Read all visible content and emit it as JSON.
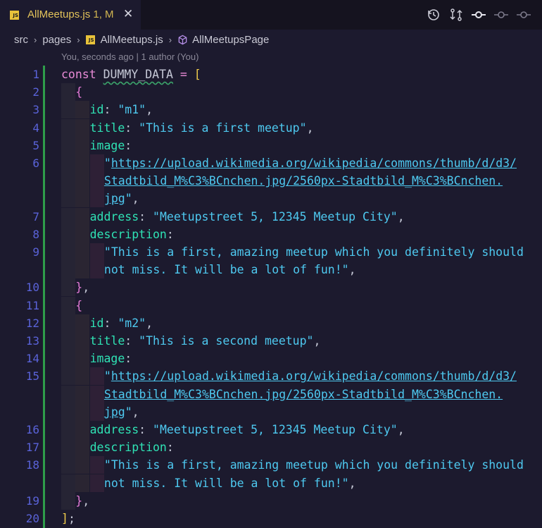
{
  "tab": {
    "filename": "AllMeetups.js",
    "meta": " 1, M",
    "close_glyph": "✕",
    "language_badge": "JS"
  },
  "toolbar_icons": [
    "history-icon",
    "compare-changes-icon",
    "git-commit-icon",
    "previous-change-icon",
    "next-change-icon"
  ],
  "breadcrumb": {
    "items": [
      "src",
      "pages",
      "AllMeetups.js",
      "AllMeetupsPage"
    ],
    "separator": "›"
  },
  "blame": "You, seconds ago | 1 author (You)",
  "colors": {
    "background": "#1c1a2e",
    "line_number": "#5a63d9",
    "keyword": "#e98bd7",
    "property": "#2fe3b5",
    "string": "#4ec9f0",
    "bracket_outer": "#f0cc4c",
    "bracket_inner": "#e47ad6",
    "git_added": "#2e9d4a"
  },
  "editor": {
    "lines": [
      {
        "num": "1",
        "indent": 0,
        "tokens": [
          [
            "kw",
            "const "
          ],
          [
            "var",
            "DUMMY_DATA"
          ],
          [
            "op",
            " = "
          ],
          [
            "br-y",
            "["
          ]
        ]
      },
      {
        "num": "2",
        "indent": 1,
        "tokens": [
          [
            "br-p",
            "{"
          ]
        ]
      },
      {
        "num": "3",
        "indent": 2,
        "tokens": [
          [
            "key",
            "id"
          ],
          [
            "punc",
            ": "
          ],
          [
            "str",
            "\"m1\""
          ],
          [
            "punc",
            ","
          ]
        ]
      },
      {
        "num": "4",
        "indent": 2,
        "tokens": [
          [
            "key",
            "title"
          ],
          [
            "punc",
            ": "
          ],
          [
            "str",
            "\"This is a first meetup\""
          ],
          [
            "punc",
            ","
          ]
        ]
      },
      {
        "num": "5",
        "indent": 2,
        "tokens": [
          [
            "key",
            "image"
          ],
          [
            "punc",
            ":"
          ]
        ]
      },
      {
        "num": "6",
        "indent": 3,
        "tokens": [
          [
            "str",
            "\""
          ],
          [
            "url",
            "https://upload.wikimedia.org/wikipedia/commons/thumb/d/d3/"
          ]
        ]
      },
      {
        "num": "",
        "indent": 3,
        "tokens": [
          [
            "url",
            "Stadtbild_M%C3%BCnchen.jpg/2560px-Stadtbild_M%C3%BCnchen."
          ]
        ]
      },
      {
        "num": "",
        "indent": 3,
        "tokens": [
          [
            "url",
            "jpg"
          ],
          [
            "str",
            "\""
          ],
          [
            "punc",
            ","
          ]
        ]
      },
      {
        "num": "7",
        "indent": 2,
        "tokens": [
          [
            "key",
            "address"
          ],
          [
            "punc",
            ": "
          ],
          [
            "str",
            "\"Meetupstreet 5, 12345 Meetup City\""
          ],
          [
            "punc",
            ","
          ]
        ]
      },
      {
        "num": "8",
        "indent": 2,
        "tokens": [
          [
            "key",
            "description"
          ],
          [
            "punc",
            ":"
          ]
        ]
      },
      {
        "num": "9",
        "indent": 3,
        "tokens": [
          [
            "str",
            "\"This is a first, amazing meetup which you definitely should"
          ]
        ]
      },
      {
        "num": "",
        "indent": 3,
        "tokens": [
          [
            "str",
            "not miss. It will be a lot of fun!\""
          ],
          [
            "punc",
            ","
          ]
        ]
      },
      {
        "num": "10",
        "indent": 1,
        "tokens": [
          [
            "br-p",
            "}"
          ],
          [
            "punc",
            ","
          ]
        ]
      },
      {
        "num": "11",
        "indent": 1,
        "tokens": [
          [
            "br-p",
            "{"
          ]
        ]
      },
      {
        "num": "12",
        "indent": 2,
        "tokens": [
          [
            "key",
            "id"
          ],
          [
            "punc",
            ": "
          ],
          [
            "str",
            "\"m2\""
          ],
          [
            "punc",
            ","
          ]
        ]
      },
      {
        "num": "13",
        "indent": 2,
        "tokens": [
          [
            "key",
            "title"
          ],
          [
            "punc",
            ": "
          ],
          [
            "str",
            "\"This is a second meetup\""
          ],
          [
            "punc",
            ","
          ]
        ]
      },
      {
        "num": "14",
        "indent": 2,
        "tokens": [
          [
            "key",
            "image"
          ],
          [
            "punc",
            ":"
          ]
        ]
      },
      {
        "num": "15",
        "indent": 3,
        "tokens": [
          [
            "str",
            "\""
          ],
          [
            "url",
            "https://upload.wikimedia.org/wikipedia/commons/thumb/d/d3/"
          ]
        ]
      },
      {
        "num": "",
        "indent": 3,
        "tokens": [
          [
            "url",
            "Stadtbild_M%C3%BCnchen.jpg/2560px-Stadtbild_M%C3%BCnchen."
          ]
        ]
      },
      {
        "num": "",
        "indent": 3,
        "tokens": [
          [
            "url",
            "jpg"
          ],
          [
            "str",
            "\""
          ],
          [
            "punc",
            ","
          ]
        ]
      },
      {
        "num": "16",
        "indent": 2,
        "tokens": [
          [
            "key",
            "address"
          ],
          [
            "punc",
            ": "
          ],
          [
            "str",
            "\"Meetupstreet 5, 12345 Meetup City\""
          ],
          [
            "punc",
            ","
          ]
        ]
      },
      {
        "num": "17",
        "indent": 2,
        "tokens": [
          [
            "key",
            "description"
          ],
          [
            "punc",
            ":"
          ]
        ]
      },
      {
        "num": "18",
        "indent": 3,
        "tokens": [
          [
            "str",
            "\"This is a first, amazing meetup which you definitely should"
          ]
        ]
      },
      {
        "num": "",
        "indent": 3,
        "tokens": [
          [
            "str",
            "not miss. It will be a lot of fun!\""
          ],
          [
            "punc",
            ","
          ]
        ]
      },
      {
        "num": "19",
        "indent": 1,
        "tokens": [
          [
            "br-p",
            "}"
          ],
          [
            "punc",
            ","
          ]
        ]
      },
      {
        "num": "20",
        "indent": 0,
        "tokens": [
          [
            "br-y",
            "]"
          ],
          [
            "punc",
            ";"
          ]
        ]
      }
    ]
  }
}
